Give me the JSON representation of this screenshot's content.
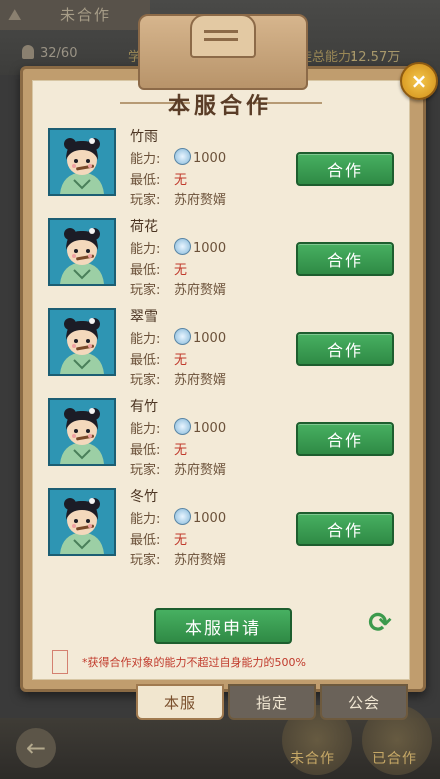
{
  "background": {
    "tab_label": "未合作",
    "count": "32/60",
    "ability_label_left": "学徒总能",
    "ability_label_right": "学徒总能力:",
    "ability_value": "12.57万",
    "bottom_left_label": "未合作",
    "bottom_right_label": "已合作"
  },
  "modal": {
    "title": "本服合作",
    "close_icon": "×",
    "rows": [
      {
        "name": "竹雨",
        "ability_label": "能力:",
        "ability_value": "1000",
        "min_label": "最低:",
        "min_value": "无",
        "player_label": "玩家:",
        "player_value": "苏府赘婿",
        "button": "合作"
      },
      {
        "name": "荷花",
        "ability_label": "能力:",
        "ability_value": "1000",
        "min_label": "最低:",
        "min_value": "无",
        "player_label": "玩家:",
        "player_value": "苏府赘婿",
        "button": "合作"
      },
      {
        "name": "翠雪",
        "ability_label": "能力:",
        "ability_value": "1000",
        "min_label": "最低:",
        "min_value": "无",
        "player_label": "玩家:",
        "player_value": "苏府赘婿",
        "button": "合作"
      },
      {
        "name": "有竹",
        "ability_label": "能力:",
        "ability_value": "1000",
        "min_label": "最低:",
        "min_value": "无",
        "player_label": "玩家:",
        "player_value": "苏府赘婿",
        "button": "合作"
      },
      {
        "name": "冬竹",
        "ability_label": "能力:",
        "ability_value": "1000",
        "min_label": "最低:",
        "min_value": "无",
        "player_label": "玩家:",
        "player_value": "苏府赘婿",
        "button": "合作"
      }
    ],
    "apply_button": "本服申请",
    "refresh_icon": "⟳",
    "note": "*获得合作对象的能力不超过自身能力的500%",
    "tabs": [
      {
        "label": "本服",
        "active": true
      },
      {
        "label": "指定",
        "active": false
      },
      {
        "label": "公会",
        "active": false
      }
    ]
  }
}
